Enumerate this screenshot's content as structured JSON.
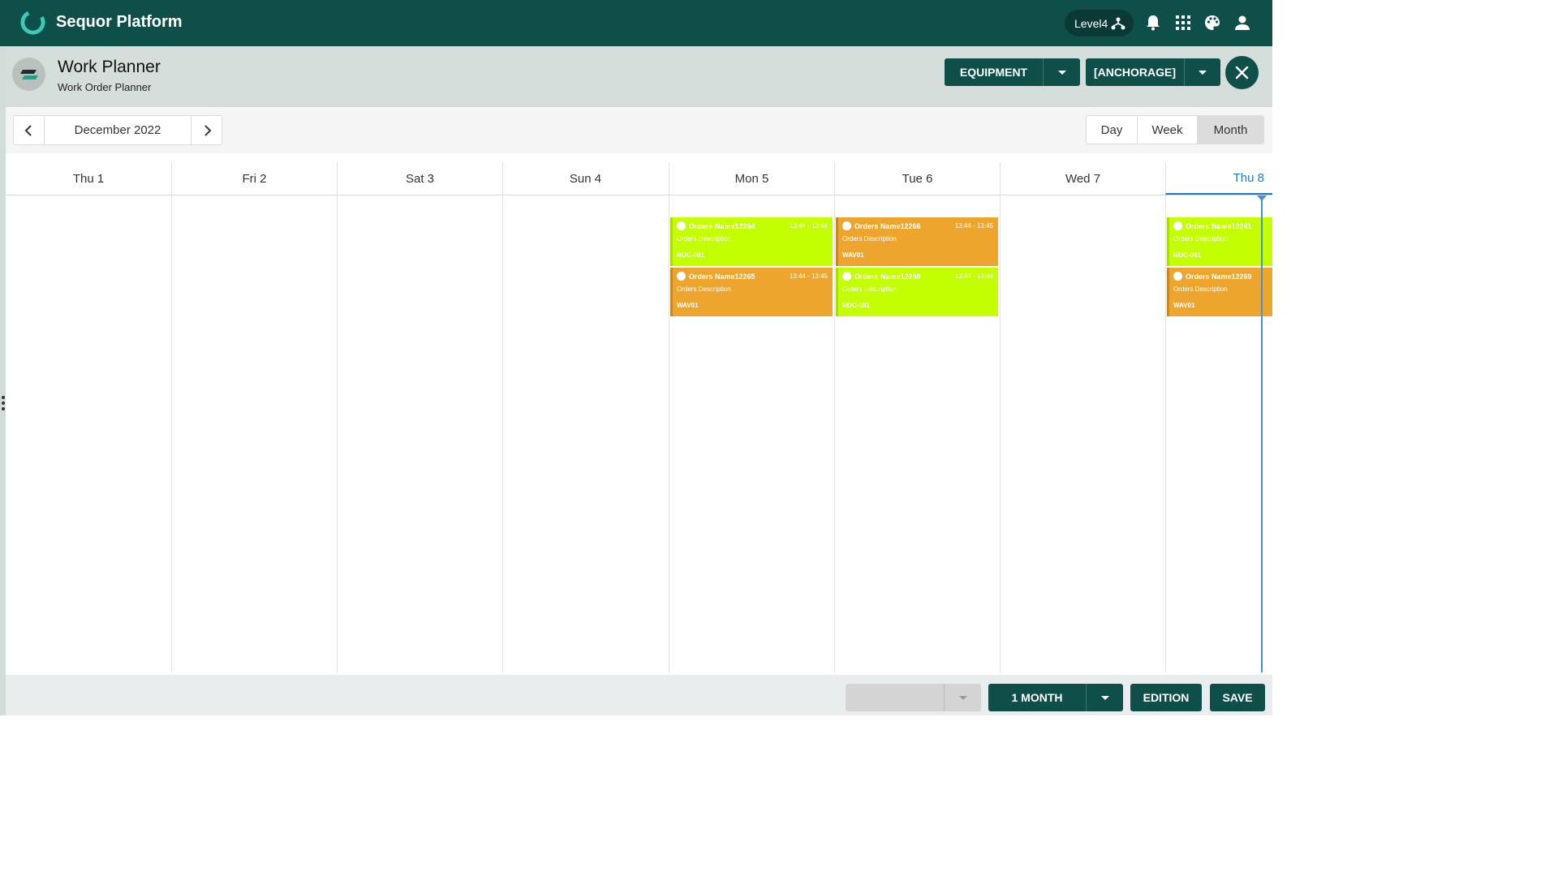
{
  "app": {
    "title": "Sequor Platform",
    "level_label": "Level4",
    "icons": [
      "hierarchy-icon",
      "bell-icon",
      "apps-grid-icon",
      "palette-icon",
      "user-icon"
    ]
  },
  "header": {
    "title": "Work Planner",
    "subtitle": "Work Order Planner",
    "equipment_label": "EQUIPMENT",
    "site_label": "[ANCHORAGE]"
  },
  "nav": {
    "period_label": "December 2022",
    "views": {
      "day": "Day",
      "week": "Week",
      "month": "Month"
    },
    "selected_view": "Month"
  },
  "calendar": {
    "days": [
      "Thu 1",
      "Fri 2",
      "Sat 3",
      "Sun 4",
      "Mon 5",
      "Tue 6",
      "Wed 7",
      "Thu 8"
    ],
    "today": "Thu 8",
    "events": [
      {
        "name": "Orders Name12264",
        "time": "13:44 - 13:44",
        "description": "Orders Description",
        "resource": "ROC-001",
        "color": "#c3ff00"
      },
      {
        "name": "Orders Name12265",
        "time": "13:44 - 13:45",
        "description": "Orders Description",
        "resource": "WAV01",
        "color": "#eda52d"
      },
      {
        "name": "Orders Name12266",
        "time": "13:44 - 13:45",
        "description": "Orders Description",
        "resource": "WAV01",
        "color": "#eda52d"
      },
      {
        "name": "Orders Name12259",
        "time": "13:44 - 13:44",
        "description": "Orders Description",
        "resource": "ROC-001",
        "color": "#c3ff00"
      },
      {
        "name": "Orders Name12261",
        "time": "",
        "description": "Orders Description",
        "resource": "ROC-001",
        "color": "#c3ff00"
      },
      {
        "name": "Orders Name12269",
        "time": "",
        "description": "Orders Description",
        "resource": "WAV01",
        "color": "#eda52d"
      }
    ]
  },
  "footer": {
    "range_label": "1 MONTH",
    "edition_label": "EDITION",
    "save_label": "SAVE"
  },
  "colors": {
    "primary": "#0f4f4a",
    "event_green": "#c3ff00",
    "event_orange": "#eda52d",
    "today_accent": "#1c7bcc"
  }
}
